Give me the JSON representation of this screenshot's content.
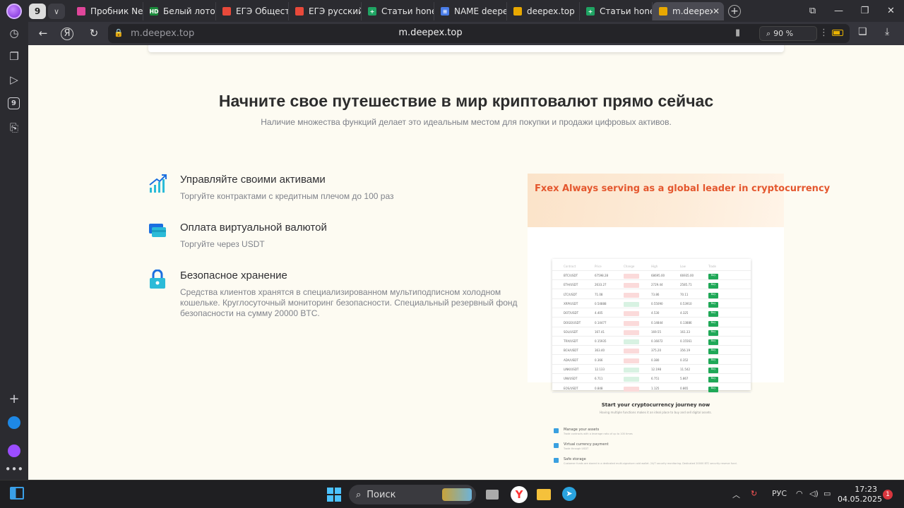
{
  "browser": {
    "tab_count": "9",
    "tabs": [
      {
        "title": "Пробник Ne",
        "fav_color": "#e0469a",
        "fav_glyph": ""
      },
      {
        "title": "Белый лотос",
        "fav_color": "#1a8a3a",
        "fav_glyph": "HD"
      },
      {
        "title": "ЕГЭ Общест",
        "fav_color": "#e8493a",
        "fav_glyph": ""
      },
      {
        "title": "ЕГЭ русский",
        "fav_color": "#e8493a",
        "fav_glyph": ""
      },
      {
        "title": "Статьи hone",
        "fav_color": "#1fa463",
        "fav_glyph": "+"
      },
      {
        "title": "NAME deepe",
        "fav_color": "#4a7de8",
        "fav_glyph": "≡"
      },
      {
        "title": "deepex.top",
        "fav_color": "#e8a800",
        "fav_glyph": ""
      },
      {
        "title": "Статьи hone",
        "fav_color": "#1fa463",
        "fav_glyph": "+"
      },
      {
        "title": "m.deepex.",
        "fav_color": "#e8a800",
        "fav_glyph": "",
        "active": true
      }
    ],
    "address_host": "m.deepex.top",
    "address_center": "m.deepex.top",
    "zoom": "90 %"
  },
  "page": {
    "headline": "Начните свое путешествие в мир криптовалют прямо сейчас",
    "subheadline": "Наличие множества функций делает это идеальным местом для покупки и продажи цифровых активов.",
    "features": [
      {
        "title": "Управляйте своими активами",
        "desc": "Торгуйте контрактами с кредитным плечом до 100 раз"
      },
      {
        "title": "Оплата виртуальной валютой",
        "desc": "Торгуйте через USDT"
      },
      {
        "title": "Безопасное хранение",
        "desc": "Средства клиентов хранятся в специализированном мультиподписном холодном кошельке. Круглосуточный мониторинг безопасности. Специальный резервный фонд безопасности на сумму 20000 BTC."
      }
    ],
    "promo_banner": "Fxex Always serving as a global leader in cryptocurrency",
    "mini_title": "Start your cryptocurrency journey now",
    "mini_sub": "Having multiple functions makes it an ideal place to buy and sell digital assets.",
    "mini_table": {
      "headers": [
        "Contract",
        "Price",
        "Change",
        "High",
        "Low",
        "Trade"
      ],
      "rows": [
        {
          "pair": "BTC/USDT",
          "price": "67598.28",
          "up": false,
          "high": "68695.00",
          "low": "66935.00"
        },
        {
          "pair": "ETH/USDT",
          "price": "2633.27",
          "up": false,
          "high": "2729.44",
          "low": "2585.71"
        },
        {
          "pair": "LTC/USDT",
          "price": "71.08",
          "up": false,
          "high": "73.86",
          "low": "70.11"
        },
        {
          "pair": "XRP/USDT",
          "price": "0.54888",
          "up": true,
          "high": "0.55090",
          "low": "0.53910"
        },
        {
          "pair": "DOT/USDT",
          "price": "4.405",
          "up": false,
          "high": "4.530",
          "low": "4.325"
        },
        {
          "pair": "DOGE/USDT",
          "price": "0.14477",
          "up": false,
          "high": "0.14844",
          "low": "0.13886"
        },
        {
          "pair": "SOL/USDT",
          "price": "167.41",
          "up": false,
          "high": "169.55",
          "low": "161.33"
        },
        {
          "pair": "TRX/USDT",
          "price": "0.15935",
          "up": true,
          "high": "0.16072",
          "low": "0.15561"
        },
        {
          "pair": "BCH/USDT",
          "price": "363.40",
          "up": false,
          "high": "375.20",
          "low": "356.19"
        },
        {
          "pair": "ADA/USDT",
          "price": "0.366",
          "up": false,
          "high": "0.380",
          "low": "0.352"
        },
        {
          "pair": "LINK/USDT",
          "price": "12.133",
          "up": true,
          "high": "12.198",
          "low": "11.542"
        },
        {
          "pair": "UNI/USDT",
          "price": "6.711",
          "up": true,
          "high": "6.751",
          "low": "5.867"
        },
        {
          "pair": "EOS/USDT",
          "price": "0.848",
          "up": false,
          "high": "1.125",
          "low": "0.865"
        }
      ],
      "buy_label": "Buy"
    },
    "mini_features": [
      {
        "title": "Manage your assets",
        "desc": "Trade contracts with a leverage ratio of up to 100 times"
      },
      {
        "title": "Virtual currency payment",
        "desc": "Trade through USDT"
      },
      {
        "title": "Safe storage",
        "desc": "Customer funds are stored in a dedicated multi-signature cold wallet. 24/7 security monitoring. Dedicated 20000 BTC security reserve fund."
      }
    ]
  },
  "taskbar": {
    "search_label": "Поиск",
    "lang": "РУС",
    "time": "17:23",
    "date": "04.05.2025",
    "notif_count": "1"
  }
}
